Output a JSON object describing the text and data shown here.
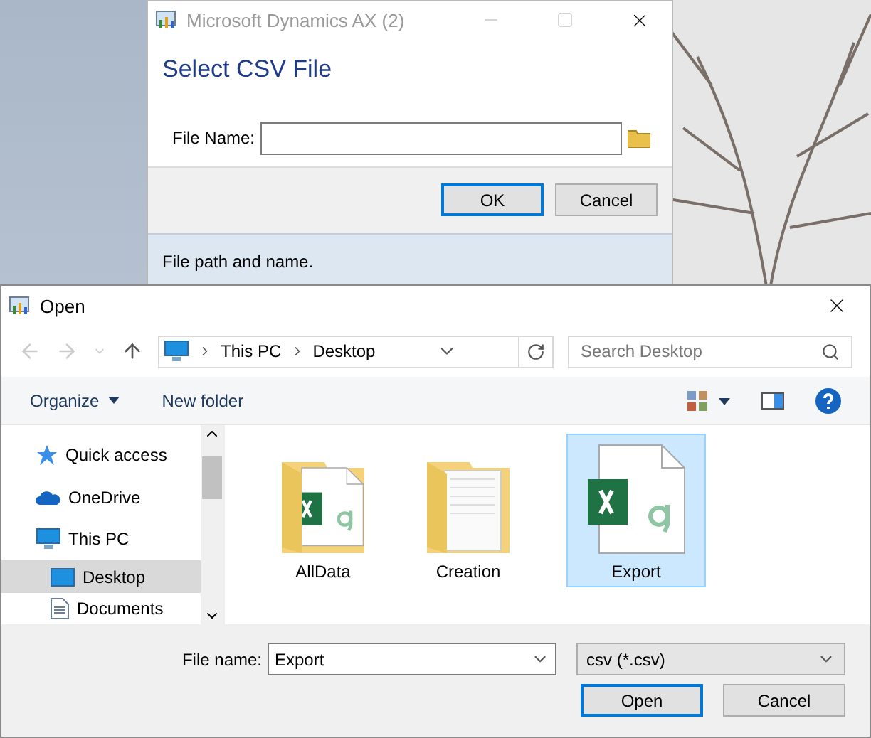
{
  "back_window": {
    "title": "Microsoft Dynamics AX (2)",
    "heading": "Select CSV File",
    "field_label": "File Name:",
    "buttons": [
      {
        "label": "OK",
        "default": true
      },
      {
        "label": "Cancel",
        "default": false
      }
    ],
    "status": "File path and name."
  },
  "open_dialog": {
    "title": "Open",
    "breadcrumb": [
      "This PC",
      "Desktop"
    ],
    "search": {
      "placeholder": "Search Desktop"
    },
    "toolbar": [
      {
        "label": "Organize",
        "dropdown": true
      },
      {
        "label": "New folder",
        "dropdown": false
      }
    ],
    "nav": [
      {
        "label": "Quick access",
        "kind": "star",
        "selected": false
      },
      {
        "label": "OneDrive",
        "kind": "cloud",
        "selected": false
      },
      {
        "label": "This PC",
        "kind": "pc",
        "selected": false,
        "children": [
          {
            "label": "Desktop",
            "kind": "desktop",
            "selected": true
          },
          {
            "label": "Documents",
            "kind": "document",
            "selected": false
          }
        ]
      }
    ],
    "files": [
      {
        "name": "AllData",
        "kind": "excel-folder",
        "selected": false
      },
      {
        "name": "Creation",
        "kind": "folder",
        "selected": false
      },
      {
        "name": "Export",
        "kind": "excel",
        "selected": true
      }
    ],
    "file_name": {
      "label": "File name:",
      "value": "Export"
    },
    "file_type": {
      "value": "csv (*.csv)"
    },
    "buttons": [
      {
        "label": "Open",
        "default": true
      },
      {
        "label": "Cancel",
        "default": false
      }
    ]
  }
}
